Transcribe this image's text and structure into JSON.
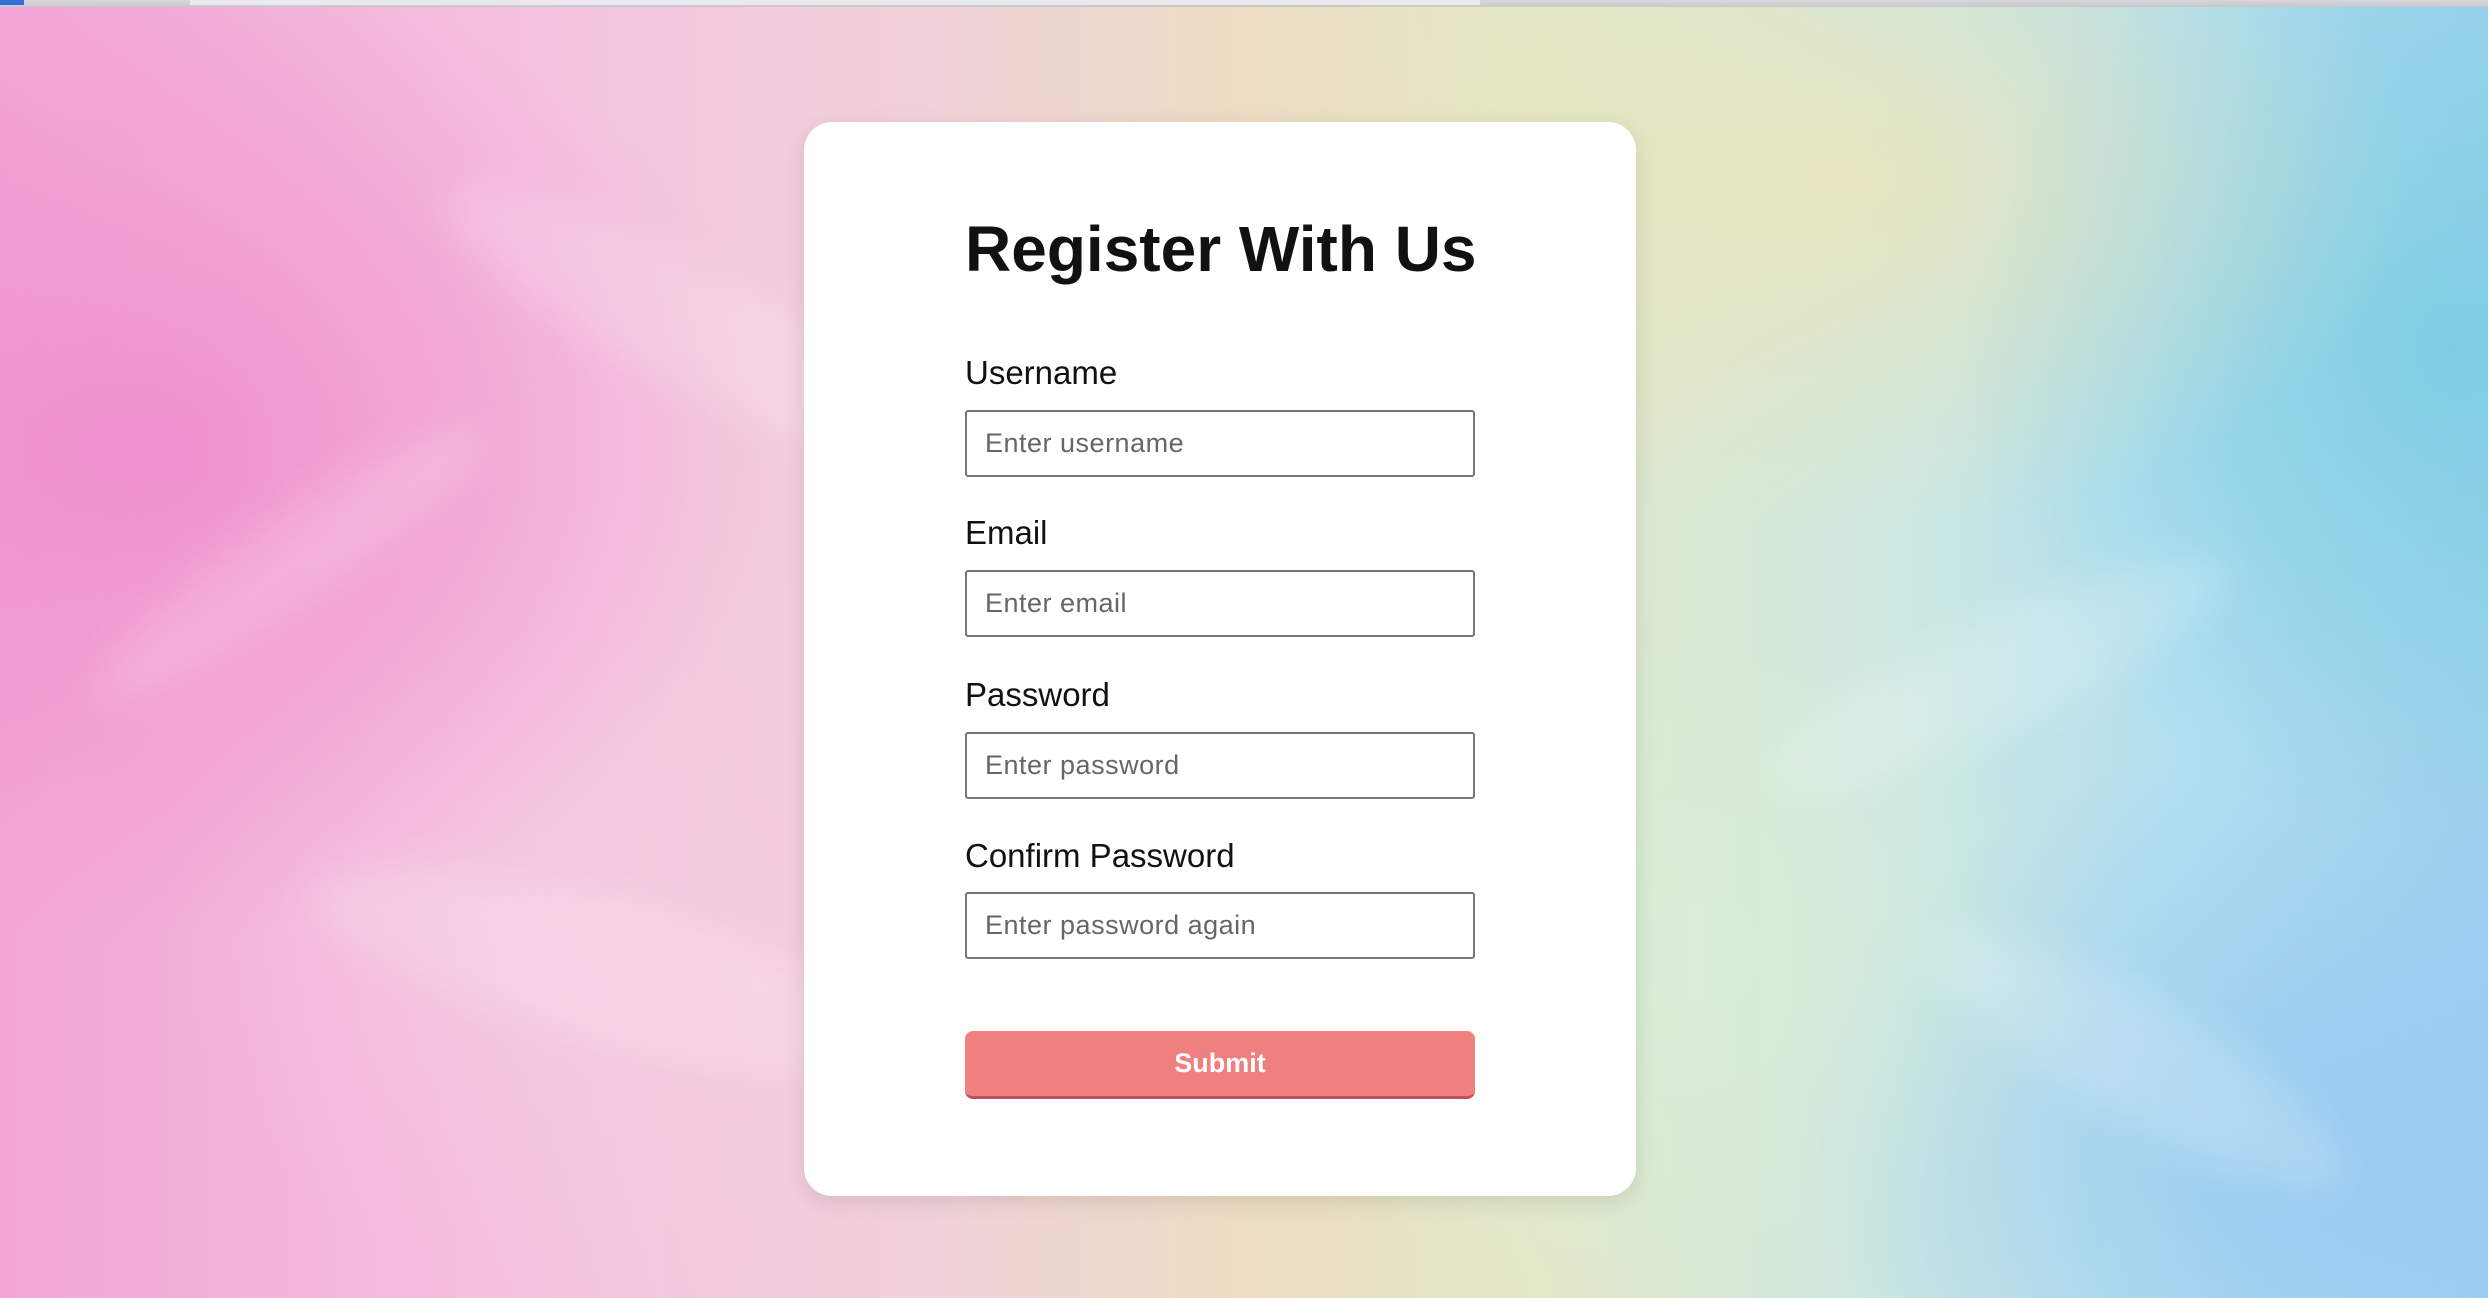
{
  "form": {
    "title": "Register With Us",
    "fields": [
      {
        "label": "Username",
        "placeholder": "Enter username"
      },
      {
        "label": "Email",
        "placeholder": "Enter email"
      },
      {
        "label": "Password",
        "placeholder": "Enter password"
      },
      {
        "label": "Confirm Password",
        "placeholder": "Enter password again"
      }
    ],
    "submit_label": "Submit"
  },
  "colors": {
    "button": "#f08080",
    "card": "#ffffff"
  }
}
